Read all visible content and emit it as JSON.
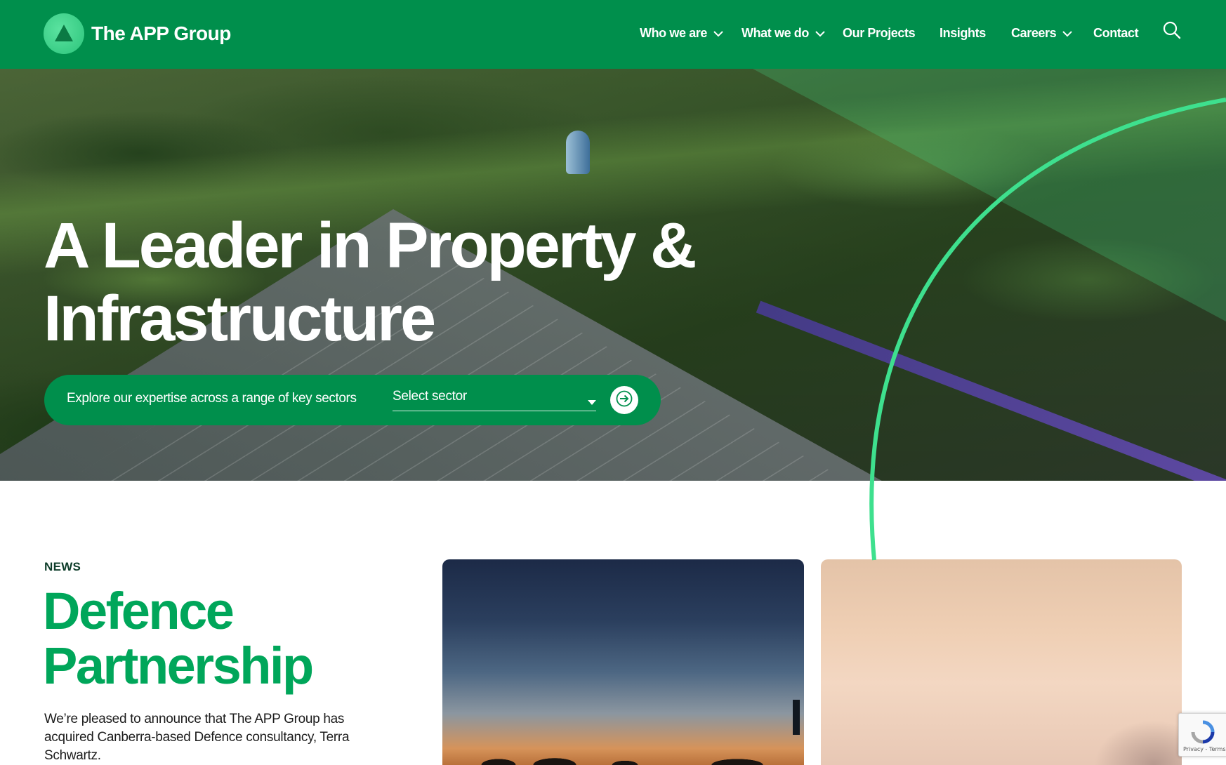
{
  "brand": {
    "name": "The APP Group",
    "primary_color": "#008f4c",
    "accent_color": "#3ee08e",
    "headline_color": "#00a65a"
  },
  "nav": {
    "items": [
      {
        "label": "Who we are",
        "has_dropdown": true
      },
      {
        "label": "What we do",
        "has_dropdown": true
      },
      {
        "label": "Our Projects",
        "has_dropdown": false
      },
      {
        "label": "Insights",
        "has_dropdown": false
      },
      {
        "label": "Careers",
        "has_dropdown": true
      },
      {
        "label": "Contact",
        "has_dropdown": false
      }
    ],
    "search_icon": "search-icon"
  },
  "hero": {
    "title_line1": "A Leader in Property &",
    "title_line2": "Infrastructure",
    "sector_prompt": "Explore our expertise across a range of key sectors",
    "sector_select_value": "Select sector"
  },
  "news": {
    "eyebrow": "NEWS",
    "title_line1": "Defence",
    "title_line2": "Partnership",
    "body": "We’re pleased to announce that The APP Group has acquired Canberra-based Defence consultancy, Terra Schwartz."
  },
  "recaptcha": {
    "text": "Privacy - Terms"
  }
}
